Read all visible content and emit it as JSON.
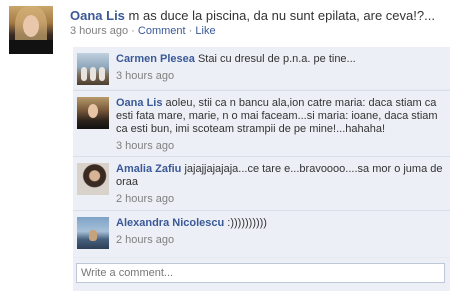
{
  "post": {
    "author": "Oana Lis",
    "text": "m as duce la piscina, da nu sunt epilata, are ceva!?...",
    "time": "3 hours ago",
    "sep": "·",
    "comment_link": "Comment",
    "like_link": "Like"
  },
  "comments": [
    {
      "author": "Carmen Plesea",
      "text": "Stai cu dresul de p.n.a. pe tine...",
      "time": "3 hours ago"
    },
    {
      "author": "Oana Lis",
      "text": "aoleu, stii ca n bancu ala,ion catre maria: daca stiam ca esti fata mare, marie, n o mai faceam...si maria: ioane, daca stiam ca esti bun, imi scoteam strampii de pe mine!...hahaha!",
      "time": "3 hours ago"
    },
    {
      "author": "Amalia Zafiu",
      "text": "jajajjajajaja...ce tare e...bravoooo....sa mor o juma de oraa",
      "time": "2 hours ago"
    },
    {
      "author": "Alexandra Nicolescu",
      "text": ":))))))))))",
      "time": "2 hours ago"
    }
  ],
  "write_comment": {
    "placeholder": "Write a comment..."
  }
}
